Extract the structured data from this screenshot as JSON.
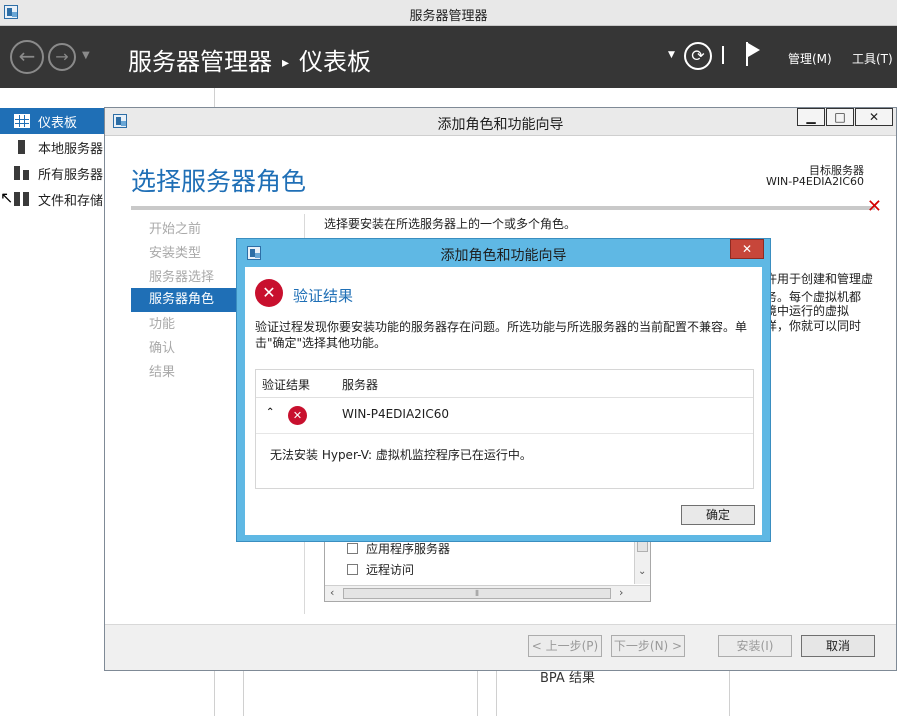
{
  "window": {
    "title": "服务器管理器"
  },
  "header": {
    "app": "服务器管理器",
    "separator": "▸",
    "page": "仪表板",
    "menu_manage": "管理(M)",
    "menu_tools": "工具(T)"
  },
  "sidebar": {
    "items": [
      {
        "label": "仪表板",
        "icon": "dashboard-grid-icon",
        "selected": true
      },
      {
        "label": "本地服务器",
        "icon": "server-icon"
      },
      {
        "label": "所有服务器",
        "icon": "servers-icon"
      },
      {
        "label": "文件和存储",
        "icon": "storage-icon"
      }
    ]
  },
  "wizard": {
    "title": "添加角色和功能向导",
    "heading": "选择服务器角色",
    "target_label": "目标服务器",
    "target_name": "WIN-P4EDIA2IC60",
    "steps": [
      "开始之前",
      "安装类型",
      "服务器选择",
      "服务器角色",
      "功能",
      "确认",
      "结果"
    ],
    "current_step": 3,
    "intro": "选择要安装在所选服务器上的一个或多个角色。",
    "description_lines": [
      "许用于创建和管理虚",
      "务。每个虚拟机都",
      "境中运行的虚拟",
      "样，你就可以同时",
      "。"
    ],
    "roles": [
      "应用程序服务器",
      "远程访问"
    ],
    "buttons": {
      "previous": "< 上一步(P)",
      "next": "下一步(N) >",
      "install": "安装(I)",
      "cancel": "取消"
    }
  },
  "background": {
    "bpa_label": "BPA 结果"
  },
  "dialog": {
    "title": "添加角色和功能向导",
    "heading": "验证结果",
    "message": "验证过程发现你要安装功能的服务器存在问题。所选功能与所选服务器的当前配置不兼容。单击\"确定\"选择其他功能。",
    "col_result": "验证结果",
    "col_server": "服务器",
    "row_server": "WIN-P4EDIA2IC60",
    "row_detail": "无法安装 Hyper-V: 虚拟机监控程序已在运行中。",
    "ok_label": "确定"
  },
  "colors": {
    "accent": "#1f6fb6",
    "header_bg": "#363636",
    "dialog_frame": "#5fb8e4",
    "error": "#c8102e"
  }
}
